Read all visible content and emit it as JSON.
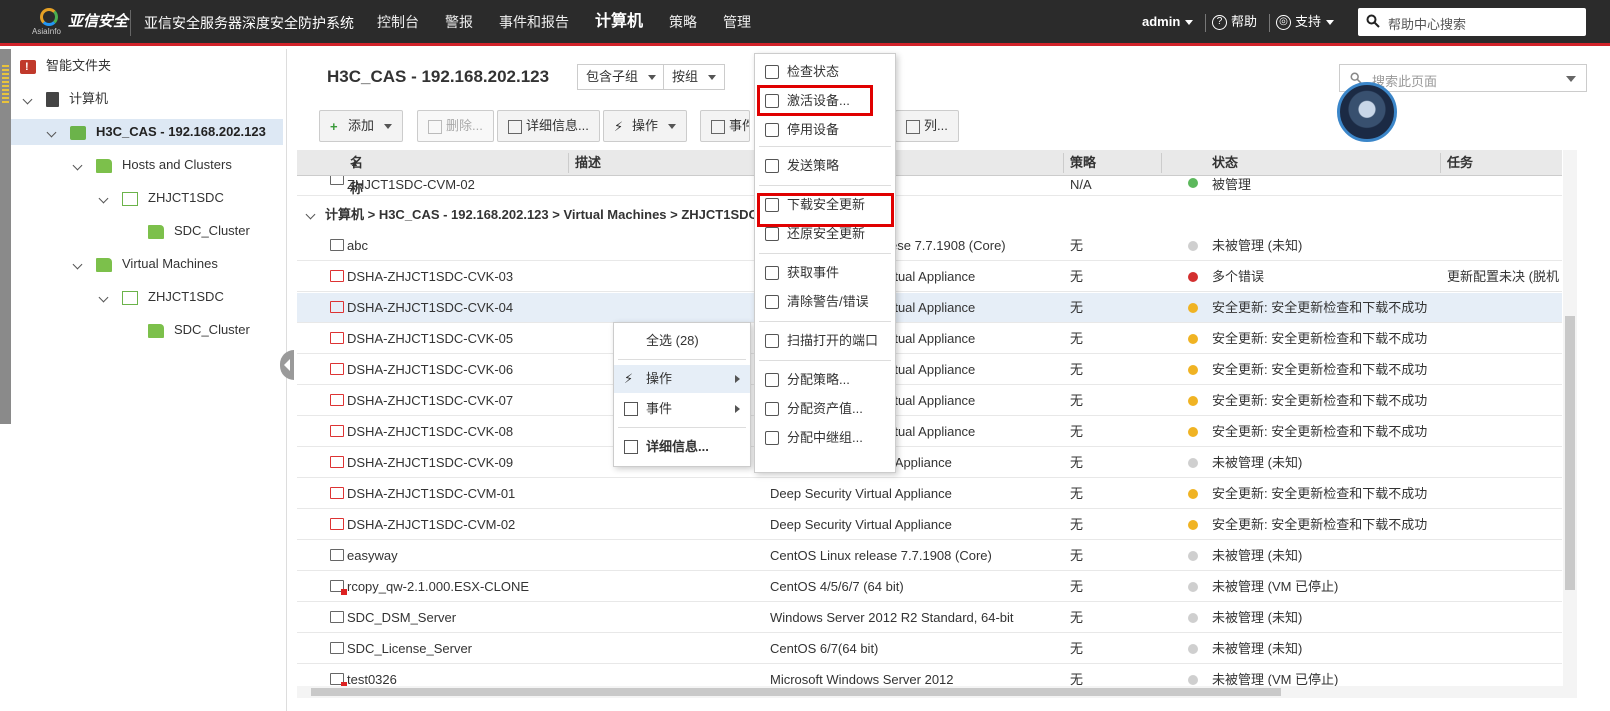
{
  "topbar": {
    "logo_sub": "AsiaInfo",
    "brand": "亚信安全",
    "product": "亚信安全服务器深度安全防护系统",
    "nav": [
      "控制台",
      "警报",
      "事件和报告",
      "计算机",
      "策略",
      "管理"
    ],
    "active_nav": "计算机",
    "user": "admin",
    "help": "帮助",
    "support": "支持",
    "search_placeholder": "帮助中心搜索"
  },
  "sidebar": {
    "items": [
      {
        "label": "智能文件夹",
        "level": 0
      },
      {
        "label": "计算机",
        "level": 0
      },
      {
        "label": "H3C_CAS - 192.168.202.123",
        "level": 1
      },
      {
        "label": "Hosts and Clusters",
        "level": 2
      },
      {
        "label": "ZHJCT1SDC",
        "level": 3
      },
      {
        "label": "SDC_Cluster",
        "level": 4
      },
      {
        "label": "Virtual Machines",
        "level": 2
      },
      {
        "label": "ZHJCT1SDC",
        "level": 3
      },
      {
        "label": "SDC_Cluster",
        "level": 4
      }
    ]
  },
  "main": {
    "title": "H3C_CAS - 192.168.202.123",
    "combo_subgroups": "包含子组",
    "combo_groupby": "按组",
    "page_search_placeholder": "搜索此页面",
    "toolbar": {
      "add": "添加",
      "delete": "删除...",
      "details": "详细信息...",
      "actions": "操作",
      "events": "事件",
      "columns": "列..."
    },
    "columns": {
      "name": "名称",
      "desc": "描述",
      "policy": "策略",
      "status": "状态",
      "task": "任务"
    },
    "top_row": {
      "name": "ZHJCT1SDC-CVM-02",
      "policy": "N/A",
      "status": "被管理"
    },
    "group_path": "计算机 > H3C_CAS - 192.168.202.123 > Virtual Machines > ZHJCT1SDC",
    "rows": [
      {
        "name": "abc",
        "os": "CentOS Linux release 7.7.1908 (Core)",
        "os_visible": "ese 7.7.1908 (Core)",
        "policy": "无",
        "status_color": "#cfcfcf",
        "status": "未被管理 (未知)",
        "task": "",
        "icon": "vm"
      },
      {
        "name": "DSHA-ZHJCT1SDC-CVK-03",
        "os_visible": "rtual Appliance",
        "policy": "无",
        "status_color": "#d32f2f",
        "status": "多个错误",
        "task": "更新配置未决 (脱机",
        "icon": "dsa"
      },
      {
        "name": "DSHA-ZHJCT1SDC-CVK-04",
        "os_visible": "rtual Appliance",
        "policy": "无",
        "status_color": "#f0b323",
        "status": "安全更新: 安全更新检查和下载不成功",
        "task": "",
        "icon": "dsa"
      },
      {
        "name": "DSHA-ZHJCT1SDC-CVK-05",
        "os_visible": "rtual Appliance",
        "policy": "无",
        "status_color": "#f0b323",
        "status": "安全更新: 安全更新检查和下载不成功",
        "task": "",
        "icon": "dsa"
      },
      {
        "name": "DSHA-ZHJCT1SDC-CVK-06",
        "os_visible": "rtual Appliance",
        "policy": "无",
        "status_color": "#f0b323",
        "status": "安全更新: 安全更新检查和下载不成功",
        "task": "",
        "icon": "dsa"
      },
      {
        "name": "DSHA-ZHJCT1SDC-CVK-07",
        "os_visible": "rtual Appliance",
        "policy": "无",
        "status_color": "#f0b323",
        "status": "安全更新: 安全更新检查和下载不成功",
        "task": "",
        "icon": "dsa"
      },
      {
        "name": "DSHA-ZHJCT1SDC-CVK-08",
        "os_visible": "rtual Appliance",
        "policy": "无",
        "status_color": "#f0b323",
        "status": "安全更新: 安全更新检查和下载不成功",
        "task": "",
        "icon": "dsa"
      },
      {
        "name": "DSHA-ZHJCT1SDC-CVK-09",
        "os_visible": "Deep Security Virtual Appliance",
        "policy": "无",
        "status_color": "#cfcfcf",
        "status": "未被管理 (未知)",
        "task": "",
        "icon": "dsa"
      },
      {
        "name": "DSHA-ZHJCT1SDC-CVM-01",
        "os_visible": "Deep Security Virtual Appliance",
        "policy": "无",
        "status_color": "#f0b323",
        "status": "安全更新: 安全更新检查和下载不成功",
        "task": "",
        "icon": "dsa"
      },
      {
        "name": "DSHA-ZHJCT1SDC-CVM-02",
        "os_visible": "Deep Security Virtual Appliance",
        "policy": "无",
        "status_color": "#f0b323",
        "status": "安全更新: 安全更新检查和下载不成功",
        "task": "",
        "icon": "dsa"
      },
      {
        "name": "easyway",
        "os_visible": "CentOS Linux release 7.7.1908 (Core)",
        "policy": "无",
        "status_color": "#cfcfcf",
        "status": "未被管理 (未知)",
        "task": "",
        "icon": "vm"
      },
      {
        "name": "rcopy_qw-2.1.000.ESX-CLONE",
        "os_visible": "CentOS 4/5/6/7 (64 bit)",
        "policy": "无",
        "status_color": "#cfcfcf",
        "status": "未被管理 (VM 已停止)",
        "task": "",
        "icon": "stopped"
      },
      {
        "name": "SDC_DSM_Server",
        "os_visible": "Windows Server 2012 R2 Standard, 64-bit",
        "policy": "无",
        "status_color": "#cfcfcf",
        "status": "未被管理 (未知)",
        "task": "",
        "icon": "vm"
      },
      {
        "name": "SDC_License_Server",
        "os_visible": "CentOS 6/7(64 bit)",
        "policy": "无",
        "status_color": "#cfcfcf",
        "status": "未被管理 (未知)",
        "task": "",
        "icon": "vm"
      },
      {
        "name": "test0326",
        "os_visible": "Microsoft Windows Server 2012",
        "policy": "无",
        "status_color": "#cfcfcf",
        "status": "未被管理 (VM 已停止)",
        "task": "",
        "icon": "stopped"
      }
    ]
  },
  "context_menu": {
    "items": [
      "全选 (28)",
      "操作",
      "事件",
      "详细信息..."
    ]
  },
  "actions_menu": {
    "items": [
      {
        "label": "检查状态",
        "icon": "check-status-icon"
      },
      {
        "label": "激活设备...",
        "icon": "activate-icon",
        "highlighted": true
      },
      {
        "label": "停用设备",
        "icon": "deactivate-icon"
      },
      {
        "label": "发送策略",
        "icon": "send-policy-icon"
      },
      {
        "label": "下载安全更新",
        "icon": "download-update-icon",
        "highlighted": true
      },
      {
        "label": "还原安全更新",
        "icon": "rollback-update-icon"
      },
      {
        "label": "获取事件",
        "icon": "get-events-icon"
      },
      {
        "label": "清除警告/错误",
        "icon": "clear-warnings-icon"
      },
      {
        "label": "扫描打开的端口",
        "icon": "scan-ports-icon"
      },
      {
        "label": "分配策略...",
        "icon": "assign-policy-icon"
      },
      {
        "label": "分配资产值...",
        "icon": "assign-asset-icon"
      },
      {
        "label": "分配中继组...",
        "icon": "assign-relay-icon"
      }
    ]
  },
  "colors": {
    "topbar_bg": "#2b2b2b",
    "accent_red": "#d2232a",
    "selected_bg": "#dde8f4",
    "highlight_box": "#e00000"
  }
}
